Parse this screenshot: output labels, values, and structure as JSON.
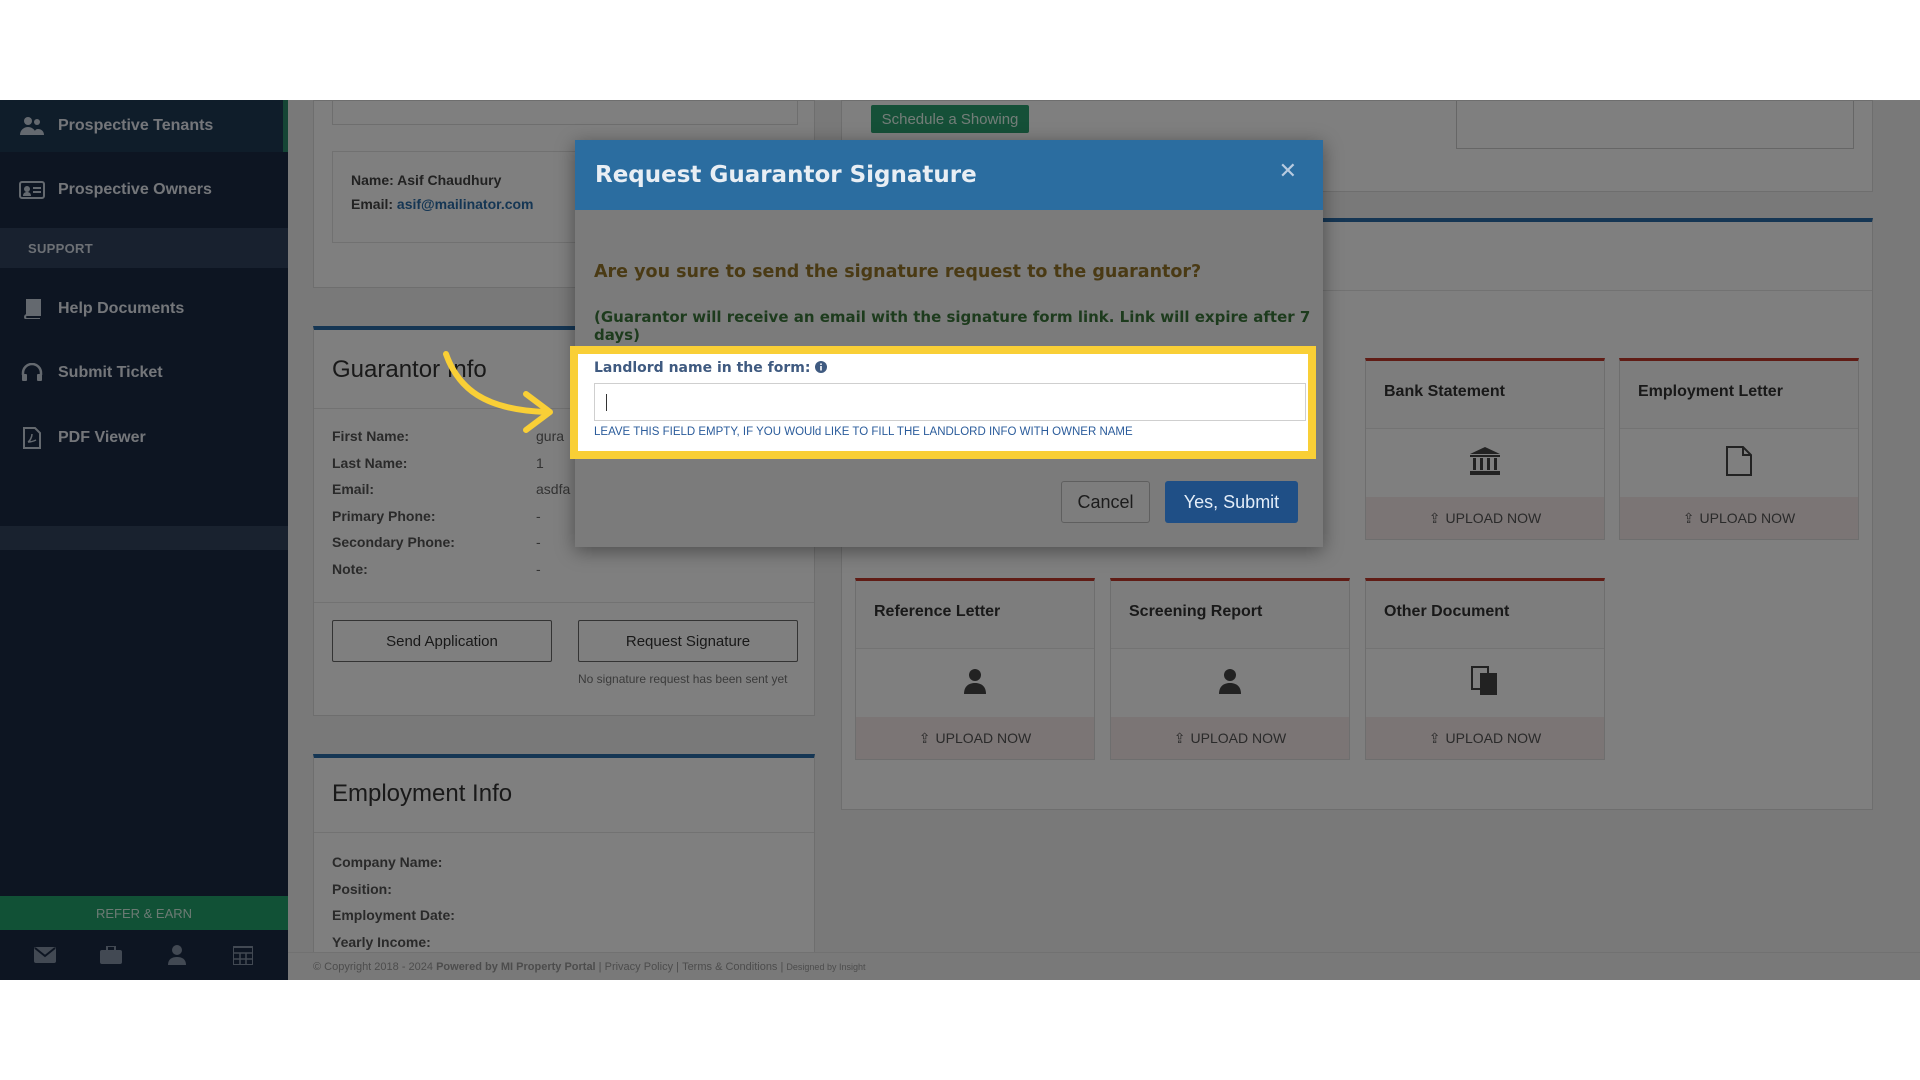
{
  "sidebar": {
    "items_top": [
      {
        "label": "Prospective Tenants",
        "icon": "users-icon"
      },
      {
        "label": "Prospective Owners",
        "icon": "id-card-icon"
      }
    ],
    "section_label": "SUPPORT",
    "items_support": [
      {
        "label": "Help Documents",
        "icon": "book-icon"
      },
      {
        "label": "Submit Ticket",
        "icon": "headset-icon"
      },
      {
        "label": "PDF Viewer",
        "icon": "pdf-icon"
      }
    ],
    "refer_label": "REFER & EARN",
    "footer_icons": [
      "mail-icon",
      "briefcase-icon",
      "user-icon",
      "calendar-icon"
    ]
  },
  "contact": {
    "name": "Name: Asif Chaudhury",
    "email_label": "Email:",
    "email_value": "asif@mailinator.com"
  },
  "schedule_button": "Schedule a Showing",
  "guarantor": {
    "title": "Guarantor Info",
    "fields": [
      {
        "label": "First Name:",
        "value": "gura"
      },
      {
        "label": "Last Name:",
        "value": "1"
      },
      {
        "label": "Email:",
        "value": "asdfa"
      },
      {
        "label": "Primary Phone:",
        "value": "-"
      },
      {
        "label": "Secondary Phone:",
        "value": "-"
      },
      {
        "label": "Note:",
        "value": "-"
      }
    ],
    "send_application": "Send Application",
    "request_signature": "Request Signature",
    "signature_status": "No signature request has been sent yet"
  },
  "employment": {
    "title": "Employment Info",
    "fields": [
      "Company Name:",
      "Position:",
      "Employment Date:",
      "Yearly Income:"
    ]
  },
  "documents": [
    {
      "title": "Bank Statement",
      "icon": "bank-icon",
      "action": "UPLOAD NOW"
    },
    {
      "title": "Employment Letter",
      "icon": "file-icon",
      "action": "UPLOAD NOW"
    },
    {
      "title": "Reference Letter",
      "icon": "user-icon",
      "action": "UPLOAD NOW"
    },
    {
      "title": "Screening Report",
      "icon": "user-icon",
      "action": "UPLOAD NOW"
    },
    {
      "title": "Other Document",
      "icon": "documents-icon",
      "action": "UPLOAD NOW"
    }
  ],
  "footer": {
    "copyright": "© Copyright 2018 - 2024",
    "powered": "Powered by MI Property Portal",
    "links": [
      "Privacy Policy",
      "Terms & Conditions"
    ],
    "designed": "Designed by Insight"
  },
  "modal": {
    "title": "Request Guarantor Signature",
    "close_icon": "close-icon",
    "question": "Are you sure to send the signature request to the guarantor?",
    "note": "(Guarantor will receive an email with the signature form link. Link will expire after 7 days)",
    "field_label": "Landlord name in the form:",
    "field_value": "",
    "field_help": "LEAVE THIS FIELD EMPTY, IF YOU WOUld LIKE TO FILL THE LANDLORD INFO WITH OWNER NAME",
    "cancel": "Cancel",
    "submit": "Yes, Submit"
  },
  "colors": {
    "sidebar": "#1b2b45",
    "modal_header": "#2b6da0",
    "highlight": "#f9cf36",
    "submit": "#1f4f86",
    "accent_green": "#2aa170"
  }
}
